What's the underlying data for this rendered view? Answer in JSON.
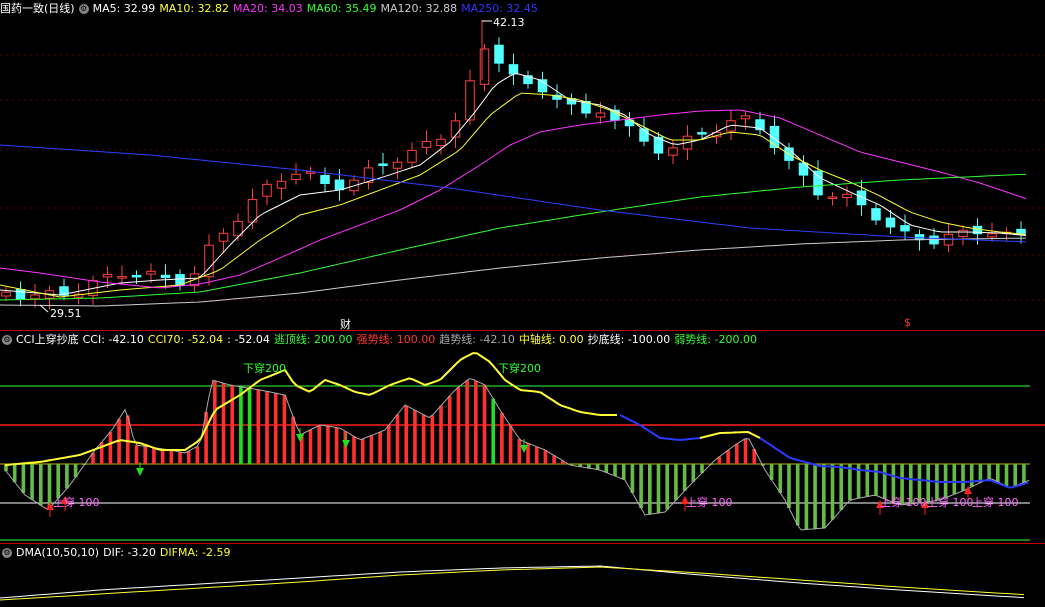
{
  "main_panel": {
    "title": "国药一致(日线)",
    "ma": [
      {
        "label": "MA5: 32.99",
        "color": "#ffffff"
      },
      {
        "label": "MA10: 32.82",
        "color": "#ffff33"
      },
      {
        "label": "MA20: 34.03",
        "color": "#ff33ff"
      },
      {
        "label": "MA60: 35.49",
        "color": "#33ff33"
      },
      {
        "label": "MA120: 32.88",
        "color": "#cccccc"
      },
      {
        "label": "MA250: 32.45",
        "color": "#3333ff"
      }
    ],
    "high_label": "42.13",
    "low_label": "29.51",
    "markers": [
      {
        "text": "财",
        "color": "#ffffff"
      },
      {
        "text": "$",
        "color": "#ff3333"
      }
    ]
  },
  "cci_panel": {
    "title": "CCI上穿抄底",
    "items": [
      {
        "label": "CCI: -42.10",
        "color": "#ffffff"
      },
      {
        "label": "CCI70: -52.04",
        "color": "#ffff33"
      },
      {
        "label": ": -52.04",
        "color": "#ffffff"
      },
      {
        "label": "逃顶线: 200.00",
        "color": "#33ff33"
      },
      {
        "label": "强势线: 100.00",
        "color": "#ff3333"
      },
      {
        "label": "趋势线: -42.10",
        "color": "#aaaaaa"
      },
      {
        "label": "中轴线: 0.00",
        "color": "#ffff33"
      },
      {
        "label": "抄底线: -100.00",
        "color": "#ffffff"
      },
      {
        "label": "弱势线: -200.00",
        "color": "#33ff33"
      }
    ],
    "annotations": [
      {
        "text": "下穿200",
        "color": "#33ff33"
      },
      {
        "text": "下穿200",
        "color": "#33ff33"
      },
      {
        "text": "上穿 100",
        "color": "#ff66ff"
      },
      {
        "text": "上穿 100",
        "color": "#ff66ff"
      },
      {
        "text": "上穿 100",
        "color": "#ff66ff"
      },
      {
        "text": "上穿 100",
        "color": "#ff66ff"
      },
      {
        "text": "上穿 100",
        "color": "#ff66ff"
      }
    ]
  },
  "dma_panel": {
    "title": "DMA(10,50,10)",
    "items": [
      {
        "label": "DIF: -3.20",
        "color": "#ffffff"
      },
      {
        "label": "DIFMA: -2.59",
        "color": "#ffff33"
      }
    ]
  }
}
